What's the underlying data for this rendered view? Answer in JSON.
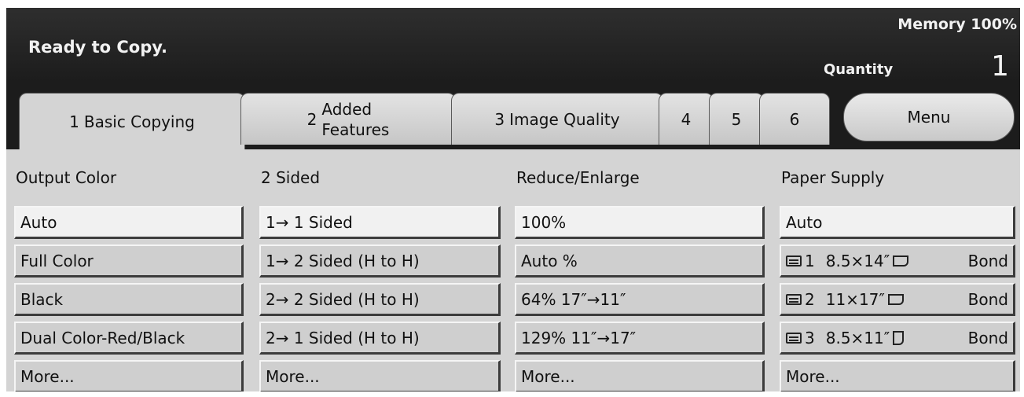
{
  "header": {
    "status": "Ready to Copy.",
    "memory": "Memory 100%",
    "quantity_label": "Quantity",
    "quantity_value": "1"
  },
  "tabs": [
    {
      "num": "1",
      "label": "Basic Copying"
    },
    {
      "num": "2",
      "label_line1": "Added",
      "label_line2": "Features"
    },
    {
      "num": "3",
      "label": "Image Quality"
    },
    {
      "num": "4"
    },
    {
      "num": "5"
    },
    {
      "num": "6"
    },
    {
      "label": "Menu"
    }
  ],
  "columns": {
    "output_color": {
      "title": "Output Color",
      "options": [
        "Auto",
        "Full Color",
        "Black",
        "Dual Color-Red/Black",
        "More..."
      ]
    },
    "two_sided": {
      "title": "2 Sided",
      "options": [
        "1→ 1 Sided",
        "1→ 2 Sided (H to H)",
        "2→ 2 Sided (H to H)",
        "2→ 1 Sided (H to H)",
        "More..."
      ]
    },
    "reduce_enlarge": {
      "title": "Reduce/Enlarge",
      "options": [
        "100%",
        "Auto %",
        "64%  17″→11″",
        "129%  11″→17″",
        "More..."
      ]
    },
    "paper_supply": {
      "title": "Paper Supply",
      "auto": "Auto",
      "trays": [
        {
          "tray": "1",
          "size": "8.5×14″",
          "type": "Bond"
        },
        {
          "tray": "2",
          "size": "11×17″",
          "type": "Bond"
        },
        {
          "tray": "3",
          "size": "8.5×11″",
          "type": "Bond"
        }
      ],
      "more": "More..."
    }
  },
  "icons": [
    "tray-icon",
    "page-landscape-icon",
    "page-portrait-icon"
  ]
}
